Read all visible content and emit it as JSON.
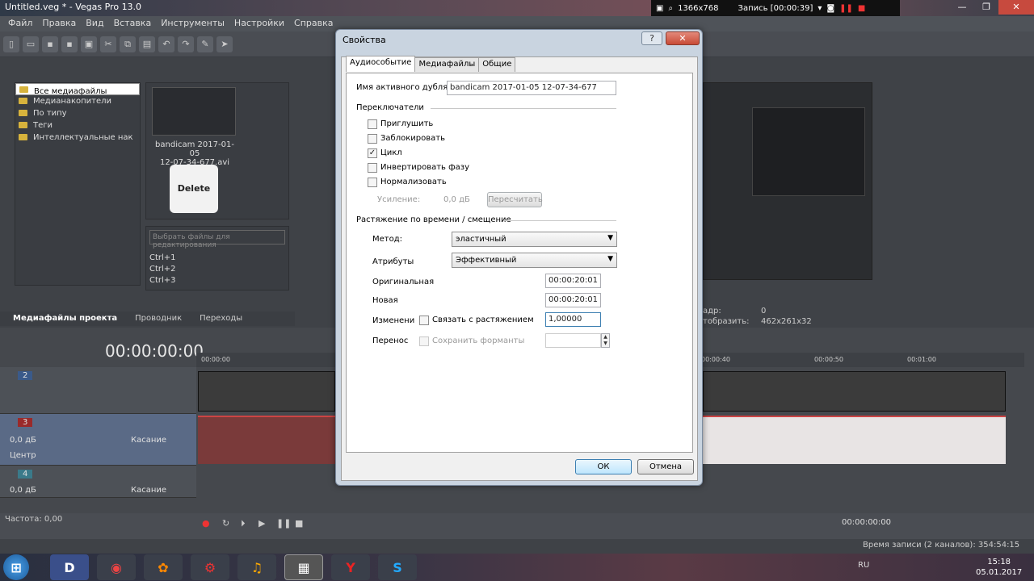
{
  "app": {
    "title": "Untitled.veg * - Vegas Pro 13.0",
    "menu": [
      "Файл",
      "Правка",
      "Вид",
      "Вставка",
      "Инструменты",
      "Настройки",
      "Справка"
    ]
  },
  "recorder": {
    "resolution": "1366x768",
    "status": "Запись [00:00:39]"
  },
  "explorer": {
    "tree": [
      "Все медиафайлы",
      "Медианакопители",
      "По типу",
      "Теги",
      "Интеллектуальные нак"
    ],
    "media_name_line1": "bandicam 2017-01-05",
    "media_name_line2": "12-07-34-677.avi",
    "delete_label": "Delete",
    "search_placeholder": "Выбрать файлы для редактирования",
    "shortcuts": [
      "Ctrl+1",
      "Ctrl+2",
      "Ctrl+3"
    ],
    "tabs": [
      "Медиафайлы проекта",
      "Проводник",
      "Переходы"
    ]
  },
  "preview": {
    "frame_label": "адр:",
    "frame_value": "0",
    "display_label": "тобразить:",
    "display_value": "462x261x32"
  },
  "timeline": {
    "timecode": "00:00:00:00",
    "ruler": [
      "00:00:00",
      "00:00:40",
      "00:00:50",
      "00:01:00"
    ],
    "tracks": [
      {
        "num": "2"
      },
      {
        "num": "3",
        "vol": "0,0 дБ",
        "pan": "Центр",
        "mode": "Касание"
      },
      {
        "num": "4",
        "vol": "0,0 дБ",
        "mode": "Касание"
      }
    ],
    "rate": "Частота: 0,00",
    "time_display": "00:00:00:00"
  },
  "status": {
    "record_time": "Время записи (2 каналов): 354:54:15"
  },
  "taskbar": {
    "lang": "RU",
    "time": "15:18",
    "date": "05.01.2017"
  },
  "dialog": {
    "title": "Свойства",
    "help": "?",
    "close": "✕",
    "tabs": [
      "Аудиособытие",
      "Медиафайлы",
      "Общие"
    ],
    "active_take_label": "Имя активного дубля:",
    "active_take_value": "bandicam 2017-01-05 12-07-34-677",
    "switches_header": "Переключатели",
    "switches": [
      {
        "label": "Приглушить",
        "checked": false
      },
      {
        "label": "Заблокировать",
        "checked": false
      },
      {
        "label": "Цикл",
        "checked": true
      },
      {
        "label": "Инвертировать фазу",
        "checked": false
      },
      {
        "label": "Нормализовать",
        "checked": false
      }
    ],
    "gain_label": "Усиление:",
    "gain_value": "0,0 дБ",
    "recalc_label": "Пересчитать",
    "stretch_header": "Растяжение по времени / смещение",
    "method_label": "Метод:",
    "method_value": "эластичный",
    "attrs_label": "Атрибуты",
    "attrs_value": "Эффективный",
    "original_label": "Оригинальная",
    "original_value": "00:00:20:01",
    "new_label": "Новая",
    "new_value": "00:00:20:01",
    "change_label": "Изменени",
    "link_label": "Связать с растяжением",
    "change_value": "1,00000",
    "transfer_label": "Перенос",
    "formants_label": "Сохранить форманты",
    "ok": "ОК",
    "cancel": "Отмена"
  }
}
